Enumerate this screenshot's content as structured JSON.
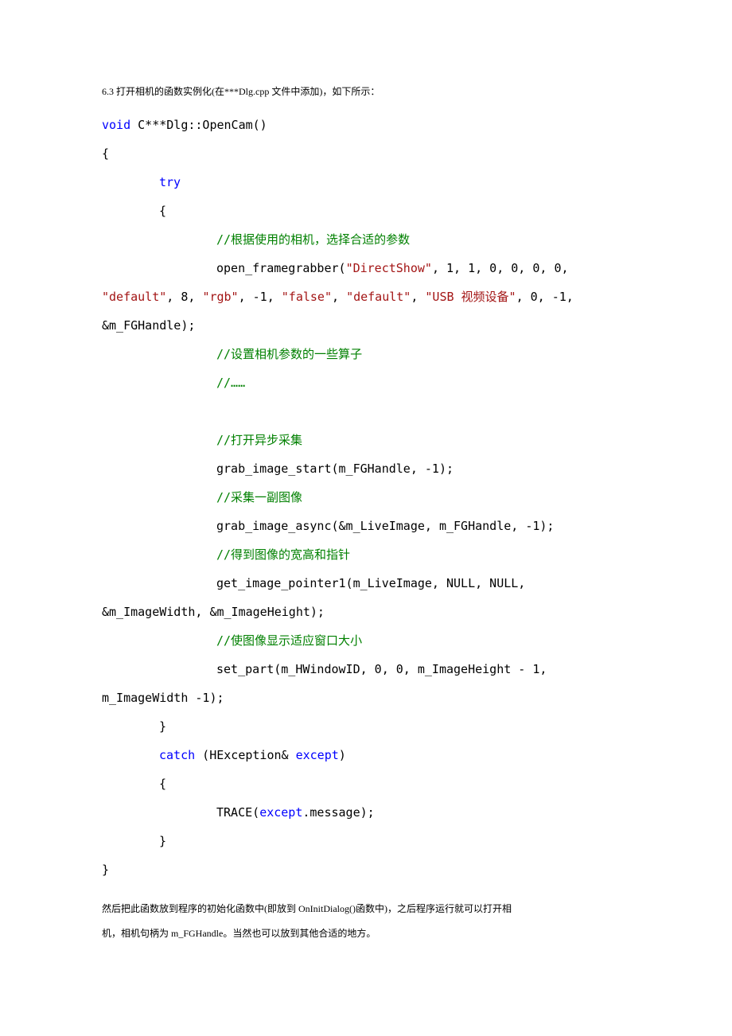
{
  "intro": "6.3 打开相机的函数实例化(在***Dlg.cpp 文件中添加)，如下所示：",
  "outro1": "然后把此函数放到程序的初始化函数中(即放到 OnInitDialog()函数中)，之后程序运行就可以打开相",
  "outro2": "机，相机句柄为 m_FGHandle。当然也可以放到其他合适的地方。",
  "code": {
    "l1_void": "void",
    "l1_rest": " C***Dlg::OpenCam()",
    "l2": "{",
    "l3_try": "try",
    "l4": "{",
    "c1": "//根据使用的相机，选择合适的参数",
    "l5a": "open_framegrabber(",
    "s_directshow": "\"DirectShow\"",
    "l5b": ", 1, 1, 0, 0, 0, 0,",
    "s_default1": "\"default\"",
    "l5c": ", 8, ",
    "s_rgb": "\"rgb\"",
    "l5d": ", -1, ",
    "s_false": "\"false\"",
    "l5e": ", ",
    "s_default2": "\"default\"",
    "l5f": ", ",
    "s_usb": "\"USB 视频设备\"",
    "l5g": ", 0, -1,",
    "l5h": "&m_FGHandle);",
    "c2": "//设置相机参数的一些算子",
    "c3": "//……",
    "blank": "",
    "c4": "//打开异步采集",
    "l6": "grab_image_start(m_FGHandle, -1);",
    "c5": "//采集一副图像",
    "l7": "grab_image_async(&m_LiveImage, m_FGHandle, -1);",
    "c6": "//得到图像的宽高和指针",
    "l8a": "get_image_pointer1(m_LiveImage, NULL, NULL,",
    "l8b": "&m_ImageWidth, &m_ImageHeight);",
    "c7": "//使图像显示适应窗口大小",
    "l9a": "set_part(m_HWindowID, 0, 0, m_ImageHeight - 1,",
    "l9b": "m_ImageWidth -1);",
    "l10": "}",
    "l11_catch": "catch",
    "l11_rest": " (HException& ",
    "l11_except": "except",
    "l11_close": ")",
    "l12": "{",
    "l13a": "TRACE(",
    "l13_except": "except",
    "l13b": ".message);",
    "l14": "}",
    "l15": "}"
  }
}
